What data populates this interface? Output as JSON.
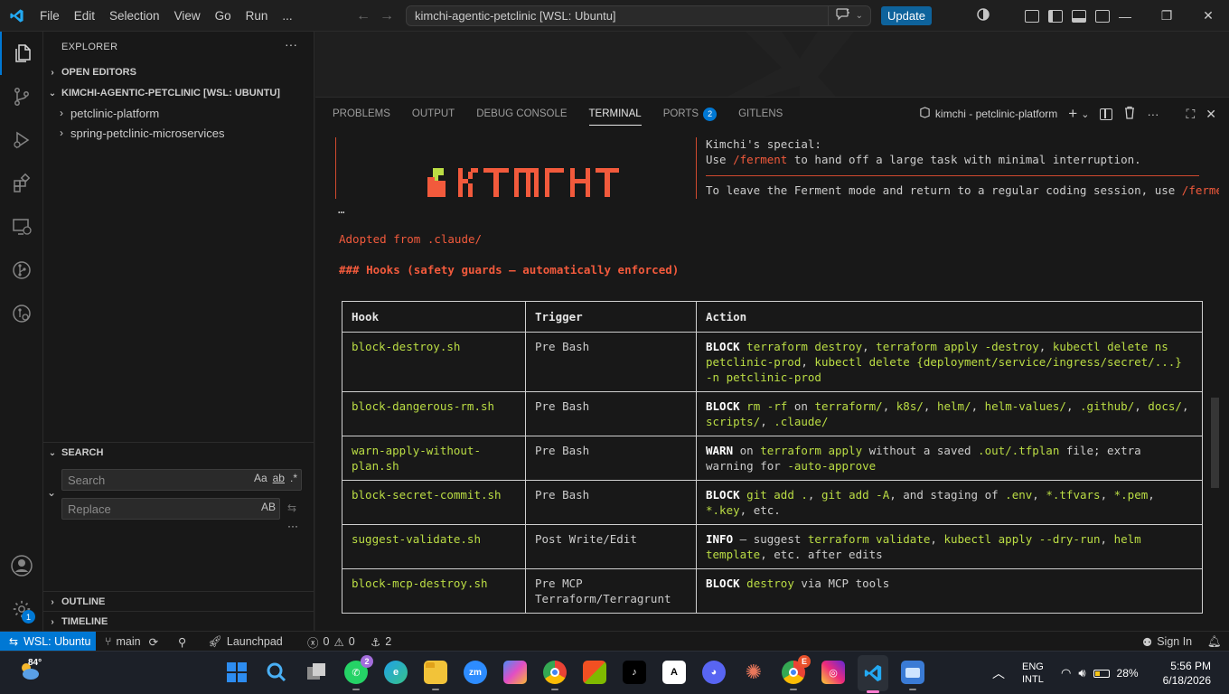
{
  "titlebar": {
    "menus": [
      "File",
      "Edit",
      "Selection",
      "View",
      "Go",
      "Run",
      "..."
    ],
    "command_center": "kimchi-agentic-petclinic [WSL: Ubuntu]",
    "update_label": "Update"
  },
  "activity": {
    "account_badge": "1"
  },
  "sidebar": {
    "title": "EXPLORER",
    "open_editors": "OPEN EDITORS",
    "workspace": "KIMCHI-AGENTIC-PETCLINIC [WSL: UBUNTU]",
    "folders": [
      "petclinic-platform",
      "spring-petclinic-microservices"
    ],
    "search_title": "SEARCH",
    "search_placeholder": "Search",
    "replace_placeholder": "Replace",
    "search_opts": [
      "Aa",
      "ab",
      ".*"
    ],
    "replace_opt": "AB",
    "outline": "OUTLINE",
    "timeline": "TIMELINE"
  },
  "panel": {
    "tabs": [
      {
        "label": "PROBLEMS"
      },
      {
        "label": "OUTPUT"
      },
      {
        "label": "DEBUG CONSOLE"
      },
      {
        "label": "TERMINAL"
      },
      {
        "label": "PORTS",
        "badge": "2"
      },
      {
        "label": "GITLENS"
      }
    ],
    "terminal_name": "kimchi - petclinic-platform"
  },
  "terminal": {
    "ellipsis": "…",
    "hint_title": "Kimchi's special:",
    "hint_use": "Use ",
    "hint_cmd": "/ferment",
    "hint_use_rest": " to hand off a large task with minimal interruption.",
    "hint_leave": "To leave the Ferment mode and return to a regular coding session, use ",
    "hint_leave_cmd": "/ferment",
    "adopted": "Adopted from .claude/",
    "hooks_heading": "### Hooks (safety guards — automatically enforced)",
    "table": {
      "headers": [
        "Hook",
        "Trigger",
        "Action"
      ],
      "rows": [
        {
          "hook": "block-destroy.sh",
          "trigger": "Pre Bash",
          "kw": "BLOCK",
          "action_parts": [
            [
              "g",
              "terraform destroy"
            ],
            [
              "t",
              ", "
            ],
            [
              "g",
              "terraform apply -destroy"
            ],
            [
              "t",
              ", "
            ],
            [
              "g",
              "kubectl delete ns petclinic-prod"
            ],
            [
              "t",
              ", "
            ],
            [
              "g",
              "kubectl delete {deployment/service/ingress/secret/...} -n petclinic-prod"
            ]
          ]
        },
        {
          "hook": "block-dangerous-rm.sh",
          "trigger": "Pre Bash",
          "kw": "BLOCK",
          "action_parts": [
            [
              "g",
              "rm -rf"
            ],
            [
              "t",
              " on "
            ],
            [
              "g",
              "terraform/"
            ],
            [
              "t",
              ", "
            ],
            [
              "g",
              "k8s/"
            ],
            [
              "t",
              ", "
            ],
            [
              "g",
              "helm/"
            ],
            [
              "t",
              ", "
            ],
            [
              "g",
              "helm-values/"
            ],
            [
              "t",
              ", "
            ],
            [
              "g",
              ".github/"
            ],
            [
              "t",
              ", "
            ],
            [
              "g",
              "docs/"
            ],
            [
              "t",
              ", "
            ],
            [
              "g",
              "scripts/"
            ],
            [
              "t",
              ", "
            ],
            [
              "g",
              ".claude/"
            ]
          ]
        },
        {
          "hook": "warn-apply-without-plan.sh",
          "trigger": "Pre Bash",
          "kw": "WARN",
          "action_parts": [
            [
              "t",
              " on "
            ],
            [
              "g",
              "terraform apply"
            ],
            [
              "t",
              " without a saved "
            ],
            [
              "g",
              ".out/.tfplan"
            ],
            [
              "t",
              " file; extra warning for "
            ],
            [
              "g",
              "-auto-approve"
            ]
          ]
        },
        {
          "hook": "block-secret-commit.sh",
          "trigger": "Pre Bash",
          "kw": "BLOCK",
          "action_parts": [
            [
              "g",
              "git add ."
            ],
            [
              "t",
              ", "
            ],
            [
              "g",
              "git add -A"
            ],
            [
              "t",
              ", and staging of "
            ],
            [
              "g",
              ".env"
            ],
            [
              "t",
              ", "
            ],
            [
              "g",
              "*.tfvars"
            ],
            [
              "t",
              ", "
            ],
            [
              "g",
              "*.pem"
            ],
            [
              "t",
              ", "
            ],
            [
              "g",
              "*.key"
            ],
            [
              "t",
              ", etc."
            ]
          ]
        },
        {
          "hook": "suggest-validate.sh",
          "trigger": "Post Write/Edit",
          "kw": "INFO",
          "action_parts": [
            [
              "t",
              " — suggest "
            ],
            [
              "g",
              "terraform validate"
            ],
            [
              "t",
              ", "
            ],
            [
              "g",
              "kubectl apply --dry-run"
            ],
            [
              "t",
              ", "
            ],
            [
              "g",
              "helm template"
            ],
            [
              "t",
              ", etc. after edits"
            ]
          ]
        },
        {
          "hook": "block-mcp-destroy.sh",
          "trigger": "Pre MCP Terraform/Terragrunt",
          "kw": "BLOCK",
          "action_parts": [
            [
              "g",
              "destroy"
            ],
            [
              "t",
              " via MCP tools"
            ]
          ]
        }
      ]
    }
  },
  "statusbar": {
    "remote": "WSL: Ubuntu",
    "branch": "main",
    "launchpad": "Launchpad",
    "errors": "0",
    "warnings": "0",
    "ports": "2",
    "sign_in": "Sign In"
  },
  "taskbar": {
    "weather_temp": "84°",
    "whatsapp_badge": "2",
    "chrome_badge": "E",
    "lang_top": "ENG",
    "lang_bottom": "INTL",
    "battery": "28%",
    "time": "5:56 PM",
    "date": "6/18/2026"
  },
  "colors": {
    "accent": "#0078d4",
    "terminal_green": "#bbdd44",
    "terminal_orange": "#f25a3c",
    "terminal_red": "#f14c4c"
  }
}
